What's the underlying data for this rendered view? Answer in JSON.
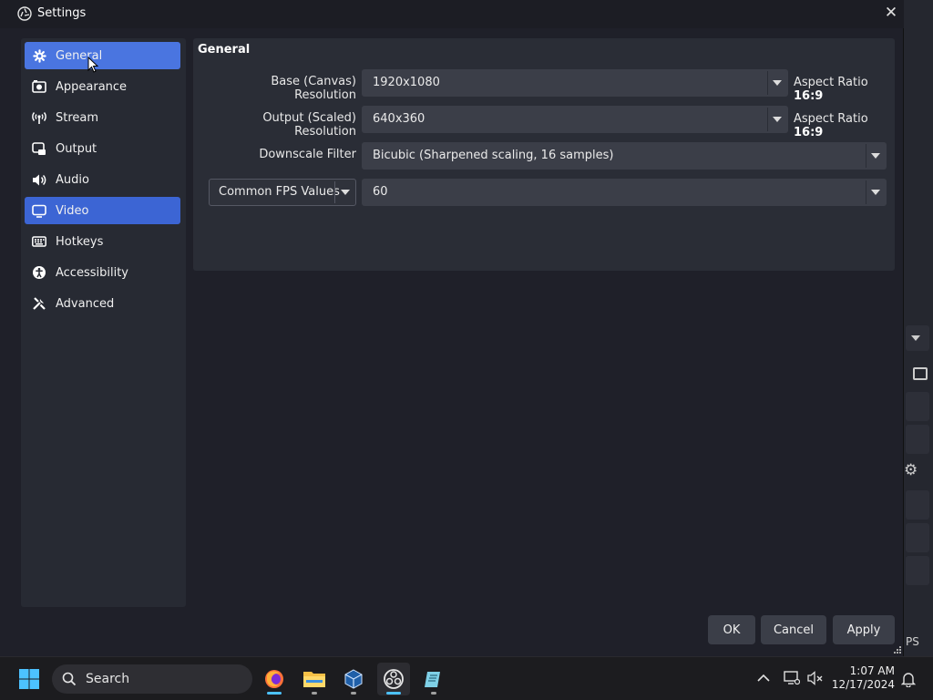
{
  "window": {
    "title": "Settings",
    "close_glyph": "✕"
  },
  "sidebar": {
    "items": [
      {
        "label": "General",
        "icon": "gear-icon",
        "state": "hover"
      },
      {
        "label": "Appearance",
        "icon": "appearance-icon"
      },
      {
        "label": "Stream",
        "icon": "broadcast-icon"
      },
      {
        "label": "Output",
        "icon": "output-icon"
      },
      {
        "label": "Audio",
        "icon": "speaker-icon"
      },
      {
        "label": "Video",
        "icon": "monitor-icon",
        "state": "selected"
      },
      {
        "label": "Hotkeys",
        "icon": "keyboard-icon"
      },
      {
        "label": "Accessibility",
        "icon": "accessibility-icon"
      },
      {
        "label": "Advanced",
        "icon": "tools-icon"
      }
    ]
  },
  "panel": {
    "title": "General",
    "base_resolution": {
      "label": "Base (Canvas) Resolution",
      "value": "1920x1080",
      "aspect_prefix": "Aspect Ratio",
      "aspect_value": "16:9"
    },
    "output_resolution": {
      "label": "Output (Scaled) Resolution",
      "value": "640x360",
      "aspect_prefix": "Aspect Ratio",
      "aspect_value": "16:9"
    },
    "downscale_filter": {
      "label": "Downscale Filter",
      "value": "Bicubic (Sharpened scaling, 16 samples)"
    },
    "fps": {
      "type_value": "Common FPS Values",
      "value": "60"
    }
  },
  "buttons": {
    "ok": "OK",
    "cancel": "Cancel",
    "apply": "Apply"
  },
  "background_app": {
    "partial_text": "PS"
  },
  "taskbar": {
    "search_label": "Search",
    "apps": [
      "firefox-icon",
      "file-explorer-icon",
      "virtualbox-icon",
      "obs-icon",
      "notepad-icon"
    ],
    "clock_time": "1:07 AM",
    "clock_date": "12/17/2024"
  },
  "colors": {
    "accent": "#3c65d4",
    "window_bg": "#1f2029",
    "panel_bg": "#2a2d36",
    "control_bg": "#3b3e48"
  }
}
